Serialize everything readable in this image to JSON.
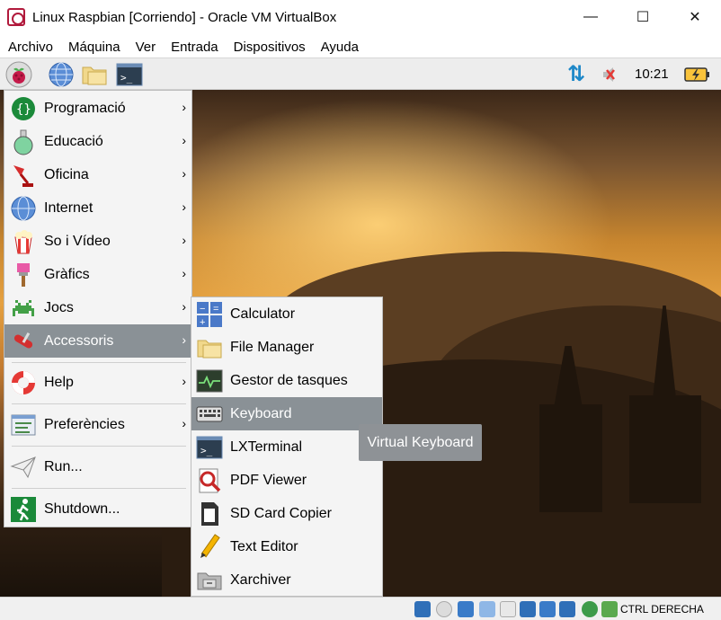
{
  "window": {
    "title": "Linux Raspbian [Corriendo] - Oracle VM VirtualBox",
    "minimize_glyph": "—",
    "maximize_glyph": "☐",
    "close_glyph": "✕"
  },
  "menubar": [
    "Archivo",
    "Máquina",
    "Ver",
    "Entrada",
    "Dispositivos",
    "Ayuda"
  ],
  "panel": {
    "clock": "10:21",
    "network_glyph": "⇅",
    "icons": [
      "raspberry-pi-logo-icon",
      "web-browser-globe-icon",
      "file-manager-folder-icon",
      "terminal-icon",
      "network-arrows-icon",
      "speaker-muted-icon",
      "battery-charging-icon"
    ]
  },
  "main_menu": [
    {
      "label": "Programació",
      "has_submenu": true,
      "icon": "programming-braces-icon"
    },
    {
      "label": "Educació",
      "has_submenu": true,
      "icon": "education-flask-icon"
    },
    {
      "label": "Oficina",
      "has_submenu": true,
      "icon": "office-lamp-icon"
    },
    {
      "label": "Internet",
      "has_submenu": true,
      "icon": "internet-globe-icon"
    },
    {
      "label": "So i Vídeo",
      "has_submenu": true,
      "icon": "popcorn-icon"
    },
    {
      "label": "Gràfics",
      "has_submenu": true,
      "icon": "paintbrush-icon"
    },
    {
      "label": "Jocs",
      "has_submenu": true,
      "icon": "space-invader-icon"
    },
    {
      "label": "Accessoris",
      "has_submenu": true,
      "icon": "swiss-knife-icon"
    },
    {
      "label": "Help",
      "has_submenu": true,
      "icon": "lifebuoy-icon"
    },
    {
      "label": "Preferències",
      "has_submenu": true,
      "icon": "preferences-panel-icon"
    },
    {
      "label": "Run...",
      "has_submenu": false,
      "icon": "paper-plane-icon"
    },
    {
      "label": "Shutdown...",
      "has_submenu": false,
      "icon": "exit-running-man-icon"
    }
  ],
  "submenu_arrow": "›",
  "accessories_submenu": [
    {
      "label": "Calculator",
      "icon": "calculator-icon"
    },
    {
      "label": "File Manager",
      "icon": "folder-icon"
    },
    {
      "label": "Gestor de tasques",
      "icon": "task-manager-icon"
    },
    {
      "label": "Keyboard",
      "icon": "keyboard-icon"
    },
    {
      "label": "LXTerminal",
      "icon": "terminal-icon"
    },
    {
      "label": "PDF Viewer",
      "icon": "pdf-magnifier-icon"
    },
    {
      "label": "SD Card Copier",
      "icon": "sd-card-icon"
    },
    {
      "label": "Text Editor",
      "icon": "pencil-icon"
    },
    {
      "label": "Xarchiver",
      "icon": "archive-box-icon"
    }
  ],
  "tooltip": "Virtual Keyboard",
  "statusbar": {
    "host_key": "CTRL DERECHA"
  },
  "colors": {
    "menu_highlight": "#8a9196",
    "tooltip_bg": "#8e9296",
    "panel_bg": "#ededed"
  }
}
